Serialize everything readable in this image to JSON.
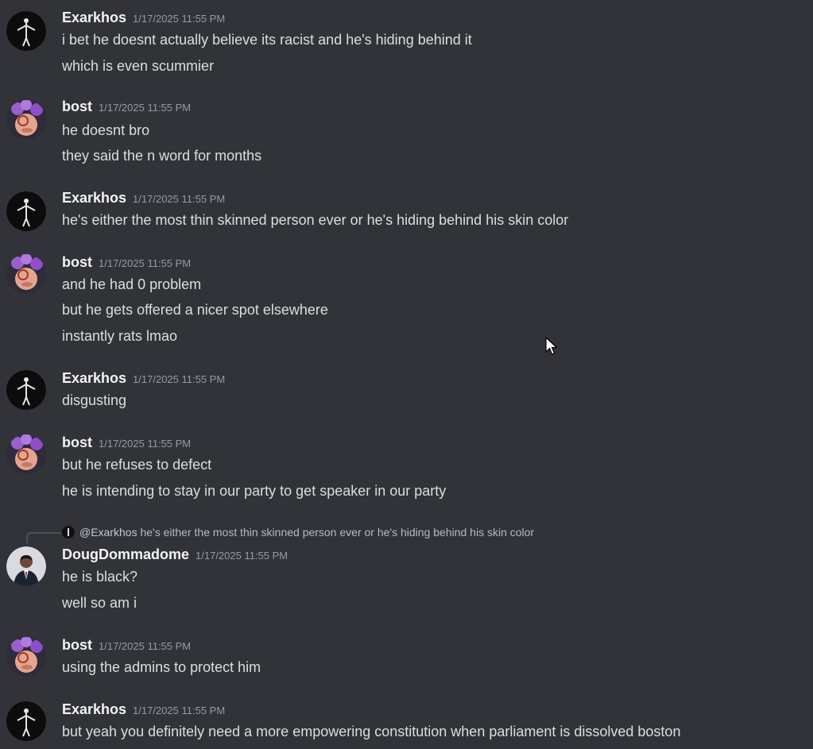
{
  "messages": [
    {
      "user": "Exarkhos",
      "avatar": "exarkhos",
      "time": "1/17/2025 11:55 PM",
      "lines": [
        "i bet he doesnt actually believe its racist and he's hiding behind it",
        "which is even scummier"
      ]
    },
    {
      "user": "bost",
      "avatar": "bost",
      "time": "1/17/2025 11:55 PM",
      "lines": [
        "he doesnt bro",
        "they said the n word for months"
      ]
    },
    {
      "user": "Exarkhos",
      "avatar": "exarkhos",
      "time": "1/17/2025 11:55 PM",
      "lines": [
        "he's either the most thin skinned person ever or he's hiding behind his skin color"
      ]
    },
    {
      "user": "bost",
      "avatar": "bost",
      "time": "1/17/2025 11:55 PM",
      "lines": [
        "and he had 0 problem",
        "but he gets offered a nicer spot elsewhere",
        "instantly rats lmao"
      ]
    },
    {
      "user": "Exarkhos",
      "avatar": "exarkhos",
      "time": "1/17/2025 11:55 PM",
      "lines": [
        "disgusting"
      ]
    },
    {
      "user": "bost",
      "avatar": "bost",
      "time": "1/17/2025 11:55 PM",
      "lines": [
        "but he refuses to defect",
        "he is intending to stay in our party to get speaker in our party"
      ]
    },
    {
      "user": "DougDommadome",
      "avatar": "doug",
      "time": "1/17/2025 11:55 PM",
      "lines": [
        "he is black?",
        "well so am i"
      ],
      "reply": {
        "mention": "@Exarkhos",
        "text": "he's either the most thin skinned person ever or he's hiding behind his skin color"
      }
    },
    {
      "user": "bost",
      "avatar": "bost",
      "time": "1/17/2025 11:55 PM",
      "lines": [
        "using the admins to protect him"
      ]
    },
    {
      "user": "Exarkhos",
      "avatar": "exarkhos",
      "time": "1/17/2025 11:55 PM",
      "lines": [
        "but yeah you definitely need a more empowering constitution when parliament is dissolved boston"
      ]
    }
  ],
  "colors": {
    "background": "#313338",
    "username": "#f2f3f5",
    "timestamp": "#949ba4",
    "text": "#dbdee1"
  },
  "icons": {
    "cursor": "mouse-pointer-icon"
  }
}
